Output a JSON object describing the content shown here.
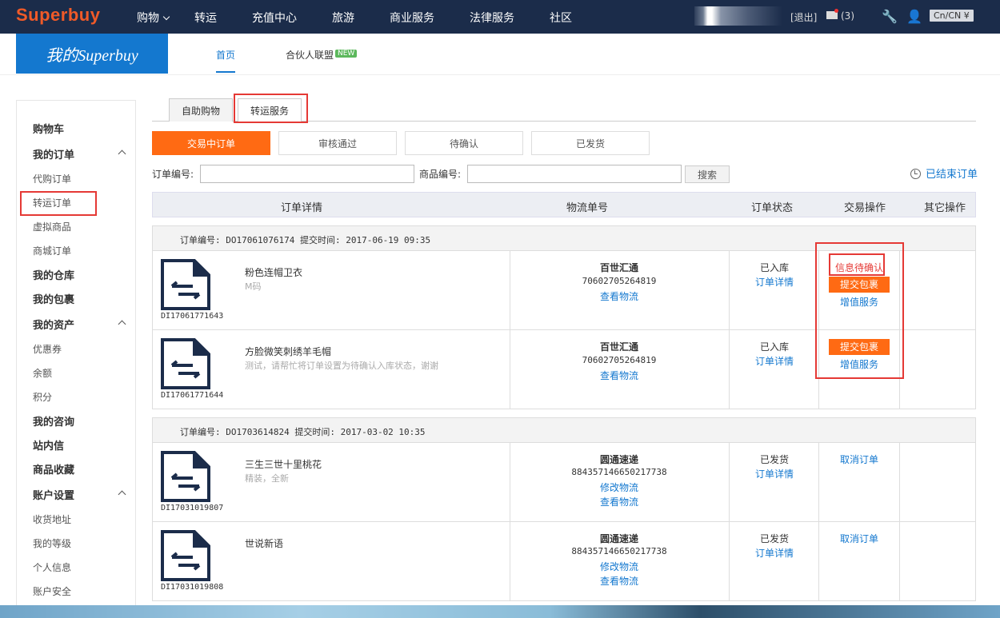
{
  "header": {
    "logo": "Superbuy",
    "nav": [
      "购物",
      "转运",
      "充值中心",
      "旅游",
      "商业服务",
      "法律服务",
      "社区"
    ],
    "logout": "[退出]",
    "mail_count": "(3)",
    "lang": "Cn/CN ¥"
  },
  "subheader": {
    "title": "我的Superbuy",
    "tabs": [
      "首页",
      "合伙人联盟"
    ],
    "new_badge": "NEW"
  },
  "sidebar": {
    "items": [
      {
        "label": "购物车",
        "type": "bold"
      },
      {
        "label": "我的订单",
        "type": "bold"
      },
      {
        "label": "代购订单",
        "type": "sub"
      },
      {
        "label": "转运订单",
        "type": "sub"
      },
      {
        "label": "虚拟商品",
        "type": "sub"
      },
      {
        "label": "商城订单",
        "type": "sub"
      },
      {
        "label": "我的仓库",
        "type": "bold"
      },
      {
        "label": "我的包裹",
        "type": "bold"
      },
      {
        "label": "我的资产",
        "type": "bold"
      },
      {
        "label": "优惠券",
        "type": "sub"
      },
      {
        "label": "余额",
        "type": "sub"
      },
      {
        "label": "积分",
        "type": "sub"
      },
      {
        "label": "我的咨询",
        "type": "bold"
      },
      {
        "label": "站内信",
        "type": "bold"
      },
      {
        "label": "商品收藏",
        "type": "bold"
      },
      {
        "label": "账户设置",
        "type": "bold"
      },
      {
        "label": "收货地址",
        "type": "sub"
      },
      {
        "label": "我的等级",
        "type": "sub"
      },
      {
        "label": "个人信息",
        "type": "sub"
      },
      {
        "label": "账户安全",
        "type": "sub"
      }
    ]
  },
  "main": {
    "tabs": [
      "自助购物",
      "转运服务"
    ],
    "filters": [
      "交易中订单",
      "审核通过",
      "待确认",
      "已发货"
    ],
    "order_no_label": "订单编号:",
    "product_no_label": "商品编号:",
    "search_label": "搜索",
    "ended_label": "已结束订单",
    "columns": [
      "订单详情",
      "物流单号",
      "订单状态",
      "交易操作",
      "其它操作"
    ],
    "groups": [
      {
        "header": "订单编号: DO17061076174    提交时间: 2017-06-19 09:35",
        "rows": [
          {
            "id": "DI17061771643",
            "name": "粉色连帽卫衣",
            "desc": "M码",
            "carrier": "百世汇通",
            "tracking": "70602705264819",
            "track_link": "查看物流",
            "status": "已入库",
            "detail_link": "订单详情",
            "pending": "信息待确认",
            "submit": "提交包裹",
            "value_added": "增值服务"
          },
          {
            "id": "DI17061771644",
            "name": "方脸微笑刺绣羊毛帽",
            "desc": "测试，请帮忙将订单设置为待确认入库状态，谢谢",
            "carrier": "百世汇通",
            "tracking": "70602705264819",
            "track_link": "查看物流",
            "status": "已入库",
            "detail_link": "订单详情",
            "submit": "提交包裹",
            "value_added": "增值服务"
          }
        ]
      },
      {
        "header": "订单编号: DO1703614824     提交时间: 2017-03-02 10:35",
        "rows": [
          {
            "id": "DI17031019807",
            "name": "三生三世十里桃花",
            "desc": "精装，全新",
            "carrier": "圆通速递",
            "tracking": "884357146650217738",
            "modify_link": "修改物流",
            "track_link": "查看物流",
            "status": "已发货",
            "detail_link": "订单详情",
            "cancel": "取消订单"
          },
          {
            "id": "DI17031019808",
            "name": "世说新语",
            "desc": "",
            "carrier": "圆通速递",
            "tracking": "884357146650217738",
            "modify_link": "修改物流",
            "track_link": "查看物流",
            "status": "已发货",
            "detail_link": "订单详情",
            "cancel": "取消订单"
          }
        ]
      }
    ]
  }
}
